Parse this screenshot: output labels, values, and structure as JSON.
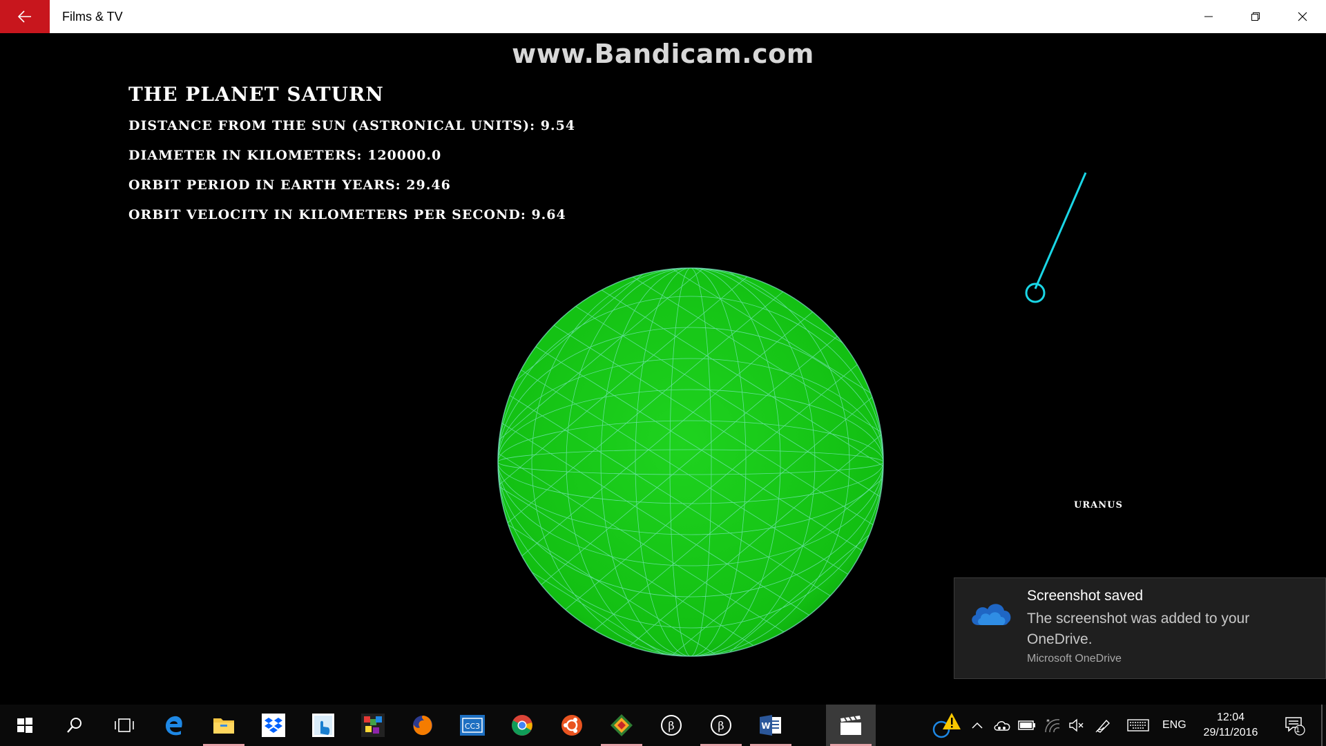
{
  "window": {
    "title": "Films & TV",
    "accent": "#c8161d"
  },
  "video": {
    "watermark": "www.Bandicam.com",
    "planet_title": "THE PLANET SATURN",
    "facts": [
      "DISTANCE FROM THE SUN (ASTRONICAL UNITS): 9.54",
      "DIAMETER IN KILOMETERS: 120000.0",
      "ORBIT PERIOD IN EARTH YEARS: 29.46",
      "ORBIT VELOCITY IN KILOMETERS PER SECOND: 9.64"
    ],
    "other_planet_label": "URANUS",
    "sphere_color": "#16c416",
    "probe_color": "#1ad6e6"
  },
  "toast": {
    "title": "Screenshot saved",
    "body": "The screenshot was added to your OneDrive.",
    "source": "Microsoft OneDrive",
    "icon": "onedrive-cloud-icon"
  },
  "taskbar": {
    "apps": [
      {
        "name": "start-icon"
      },
      {
        "name": "search-icon"
      },
      {
        "name": "task-view-icon"
      },
      {
        "name": "edge-icon"
      },
      {
        "name": "file-explorer-icon"
      },
      {
        "name": "dropbox-icon"
      },
      {
        "name": "touch-app-icon"
      },
      {
        "name": "paint-app-icon"
      },
      {
        "name": "firefox-icon"
      },
      {
        "name": "cc3-app-icon"
      },
      {
        "name": "chrome-icon"
      },
      {
        "name": "ubuntu-icon"
      },
      {
        "name": "git-app-icon"
      },
      {
        "name": "processing-icon"
      },
      {
        "name": "processing-icon-2"
      },
      {
        "name": "word-icon"
      },
      {
        "name": "films-tv-icon"
      }
    ],
    "language": "ENG",
    "time": "12:04",
    "date": "29/11/2016",
    "notification_count": "1"
  }
}
